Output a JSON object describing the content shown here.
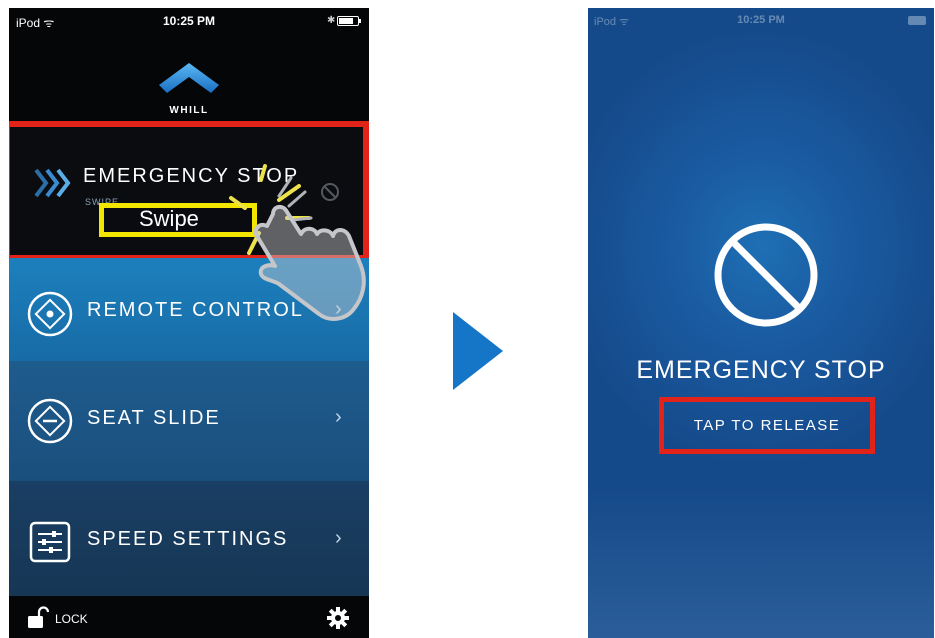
{
  "left_screen": {
    "status_bar": {
      "carrier": "iPod ᯤ",
      "time": "10:25 PM"
    },
    "logo_text": "WHILL",
    "emergency_row": {
      "label": "EMERGENCY STOP",
      "sub_label": "SWIPE",
      "gesture_hint": "Swipe"
    },
    "menu": [
      {
        "label": "REMOTE CONTROL",
        "arrow": "›",
        "icon": "remote-control-icon"
      },
      {
        "label": "SEAT SLIDE",
        "arrow": "›",
        "icon": "seat-slide-icon"
      },
      {
        "label": "SPEED SETTINGS",
        "arrow": "›",
        "icon": "speed-settings-icon"
      }
    ],
    "bottom": {
      "lock_label": "LOCK"
    }
  },
  "right_screen": {
    "status_bar": {
      "carrier": "iPod ᯤ",
      "time": "10:25 PM"
    },
    "title": "EMERGENCY STOP",
    "release_label": "TAP TO RELEASE"
  },
  "colors": {
    "highlight_red": "#e2231a",
    "swipe_yellow": "#f2e500",
    "arrow_blue": "#1576c8"
  }
}
